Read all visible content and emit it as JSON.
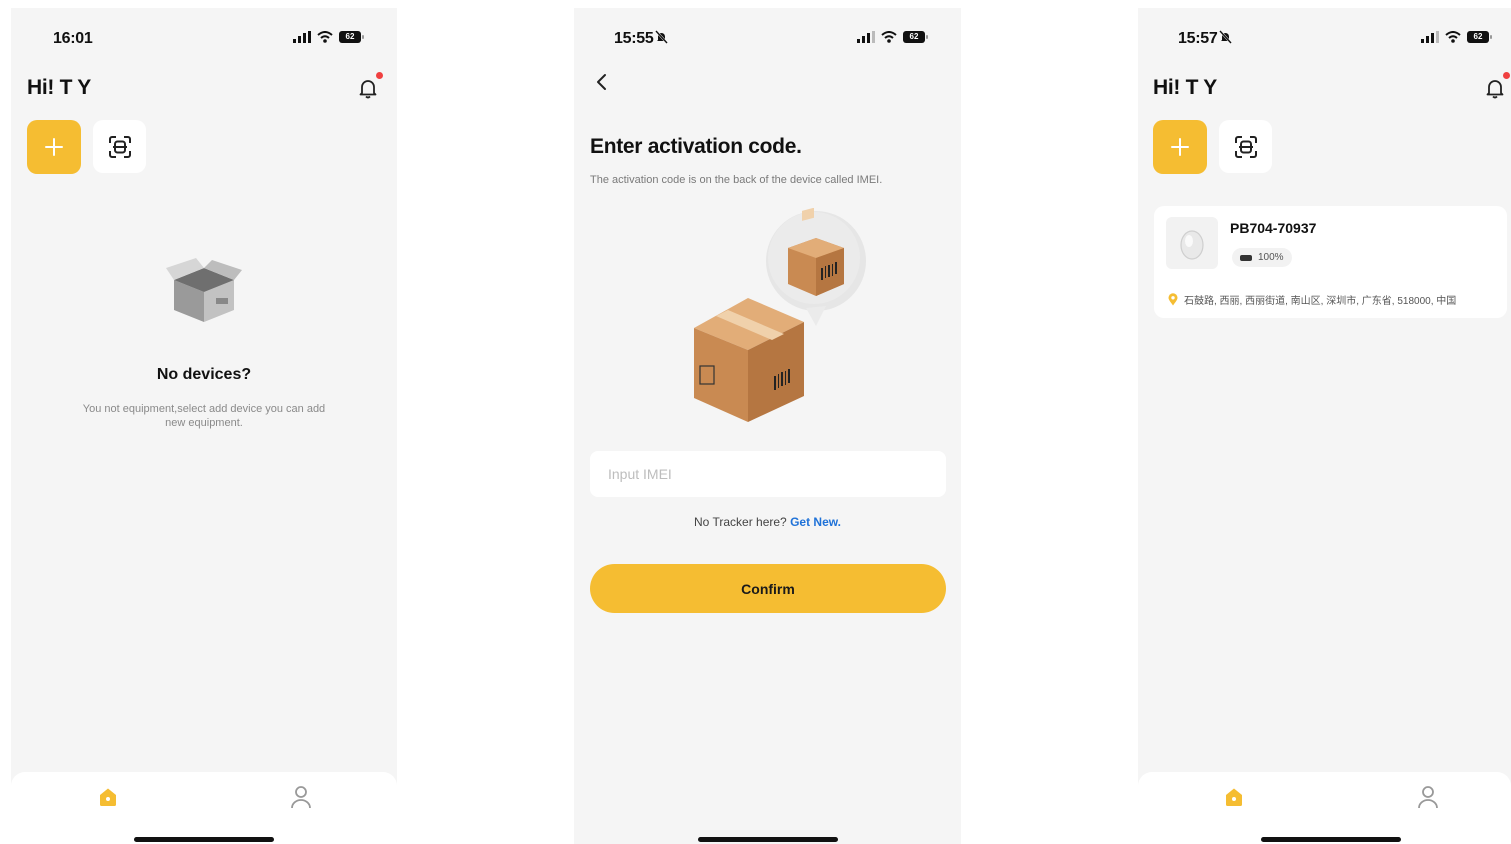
{
  "screen_home_empty": {
    "status_time": "16:01",
    "battery": "62",
    "greeting": "Hi! T Y",
    "empty_title": "No devices?",
    "empty_desc": "You not equipment,select add device you can add new equipment."
  },
  "screen_activation": {
    "status_time": "15:55",
    "battery": "62",
    "title": "Enter activation code.",
    "subtitle": "The activation code is on the back of the device called IMEI.",
    "input_placeholder": "Input IMEI",
    "no_tracker_text": "No Tracker here?",
    "get_new_link": "Get New.",
    "confirm_label": "Confirm"
  },
  "screen_home_device": {
    "status_time": "15:57",
    "battery": "62",
    "greeting": "Hi! T Y",
    "device": {
      "name": "PB704-70937",
      "battery": "100%",
      "address": "石鼓路, 西丽, 西丽街道, 南山区, 深圳市, 广东省, 518000, 中国"
    }
  },
  "icons": {
    "add": "plus-icon",
    "scan": "scan-icon",
    "notification": "bell-icon",
    "home_tab": "home-icon",
    "profile_tab": "user-icon",
    "back": "chevron-left-icon",
    "location": "location-pin-icon"
  },
  "colors": {
    "accent": "#f5bd32",
    "link": "#1f72d8",
    "notification_dot": "#f04040",
    "screen_bg": "#f5f5f5"
  }
}
